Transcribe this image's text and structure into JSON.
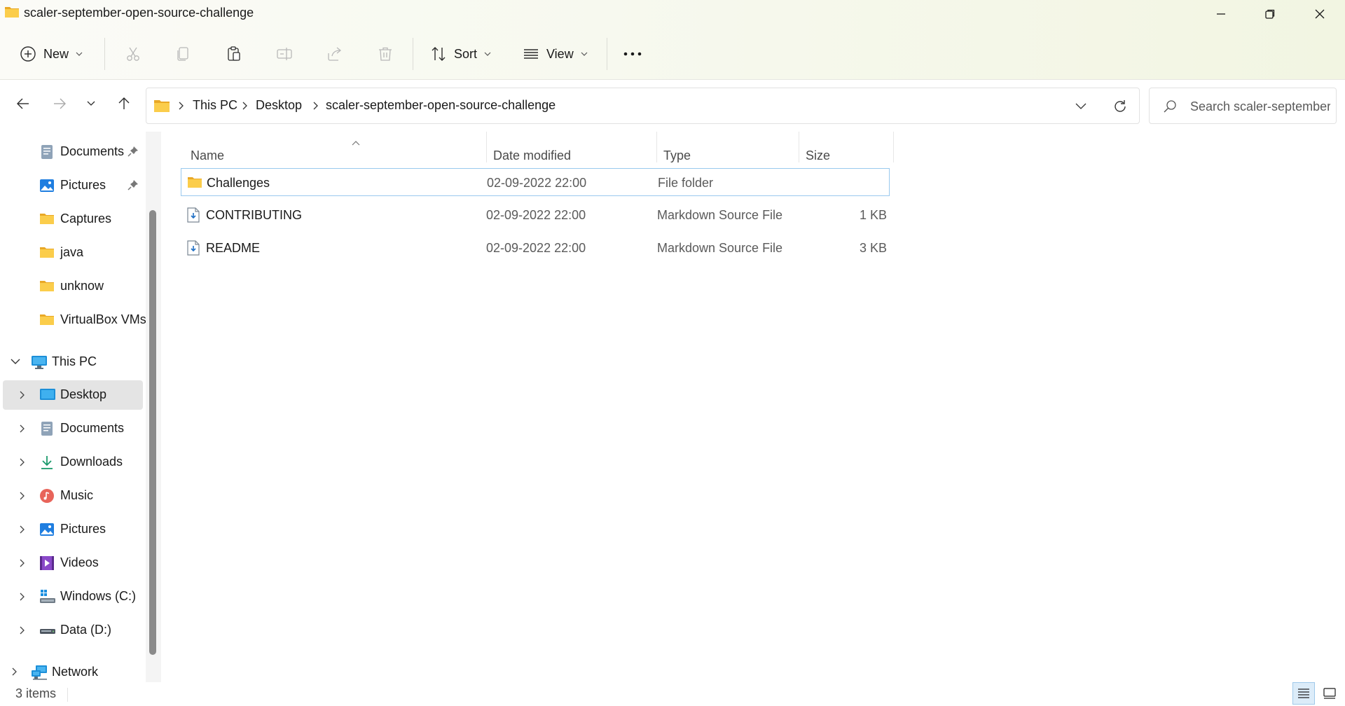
{
  "window": {
    "title": "scaler-september-open-source-challenge",
    "controls": [
      "minimize",
      "restore",
      "close"
    ]
  },
  "toolbar": {
    "new_label": "New",
    "sort_label": "Sort",
    "view_label": "View",
    "icons": [
      "plus-circle-icon",
      "cut-icon",
      "copy-icon",
      "paste-icon",
      "rename-icon",
      "share-icon",
      "delete-icon",
      "sort-icon",
      "view-icon",
      "more-icon"
    ]
  },
  "address": {
    "crumbs": [
      "This PC",
      "Desktop",
      "scaler-september-open-source-challenge"
    ]
  },
  "search": {
    "placeholder": "Search scaler-september..."
  },
  "sidebar": {
    "quick": [
      {
        "label": "Documents",
        "icon": "documents-icon",
        "pinned": true
      },
      {
        "label": "Pictures",
        "icon": "pictures-icon",
        "pinned": true
      },
      {
        "label": "Captures",
        "icon": "folder-icon"
      },
      {
        "label": "java",
        "icon": "folder-icon"
      },
      {
        "label": "unknow",
        "icon": "folder-icon"
      },
      {
        "label": "VirtualBox VMs",
        "icon": "folder-icon"
      }
    ],
    "this_pc": {
      "label": "This PC",
      "icon": "computer-icon",
      "expanded": true
    },
    "this_pc_items": [
      {
        "label": "Desktop",
        "icon": "desktop-icon",
        "selected": true
      },
      {
        "label": "Documents",
        "icon": "documents-icon"
      },
      {
        "label": "Downloads",
        "icon": "downloads-icon"
      },
      {
        "label": "Music",
        "icon": "music-icon"
      },
      {
        "label": "Pictures",
        "icon": "pictures-icon"
      },
      {
        "label": "Videos",
        "icon": "videos-icon"
      },
      {
        "label": "Windows (C:)",
        "icon": "windows-drive-icon"
      },
      {
        "label": "Data (D:)",
        "icon": "drive-icon"
      }
    ],
    "network": {
      "label": "Network",
      "icon": "network-icon"
    }
  },
  "table": {
    "columns": [
      "Name",
      "Date modified",
      "Type",
      "Size"
    ],
    "rows": [
      {
        "name": "Challenges",
        "date": "02-09-2022 22:00",
        "type": "File folder",
        "size": "",
        "icon": "folder-icon"
      },
      {
        "name": "CONTRIBUTING",
        "date": "02-09-2022 22:00",
        "type": "Markdown Source File",
        "size": "1 KB",
        "icon": "markdown-file-icon"
      },
      {
        "name": "README",
        "date": "02-09-2022 22:00",
        "type": "Markdown Source File",
        "size": "3 KB",
        "icon": "markdown-file-icon"
      }
    ]
  },
  "status": {
    "count": "3 items"
  },
  "colors": {
    "accent": "#0067c0",
    "folder": "#f8c640",
    "selection_border": "#99c9ee"
  }
}
